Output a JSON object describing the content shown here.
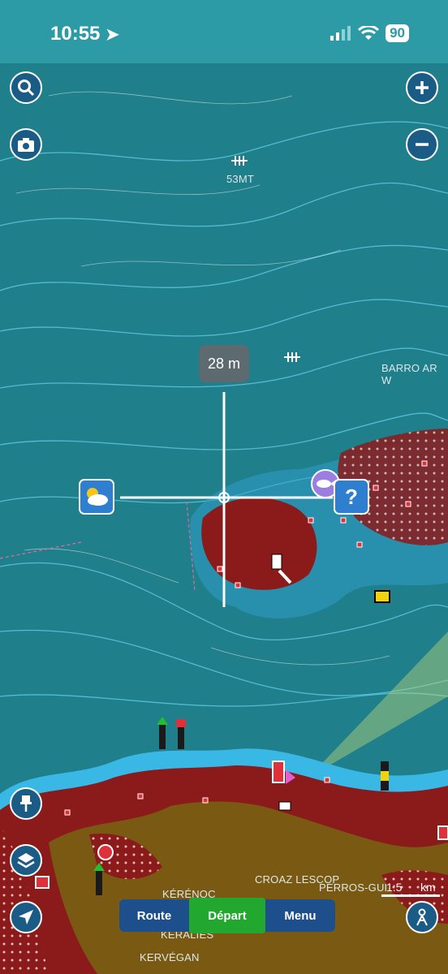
{
  "status": {
    "time": "10:55",
    "battery": "90"
  },
  "map": {
    "depth_readout": "28 m",
    "labels": [
      {
        "id": "53mt",
        "text": "53MT"
      },
      {
        "id": "barro",
        "text": "BARRO AR W"
      },
      {
        "id": "croaz",
        "text": "CROAZ LESCOP"
      },
      {
        "id": "perros",
        "text": "PERROS-GUI"
      },
      {
        "id": "kerenoc",
        "text": "KÉRÉNOC"
      },
      {
        "id": "keralies",
        "text": "KERALIES"
      },
      {
        "id": "kervegan",
        "text": "KERVÉGAN"
      }
    ],
    "scale_value": "1:5",
    "scale_unit": "km"
  },
  "bottom_bar": {
    "route_label": "Route",
    "depart_label": "Départ",
    "menu_label": "Menu"
  },
  "icons": [
    "search-icon",
    "camera-icon",
    "zoom-in-icon",
    "zoom-out-icon",
    "pin-icon",
    "layers-icon",
    "location-arrow-icon",
    "person-icon",
    "weather-icon",
    "help-icon",
    "fish-icon"
  ],
  "colors": {
    "sea": "#1f7f8a",
    "shallow": "#39b8e6",
    "land": "#7a5a12",
    "rock": "#8b1a1a",
    "accent_green": "#22a82e",
    "bar_blue": "#1d4f8c"
  }
}
